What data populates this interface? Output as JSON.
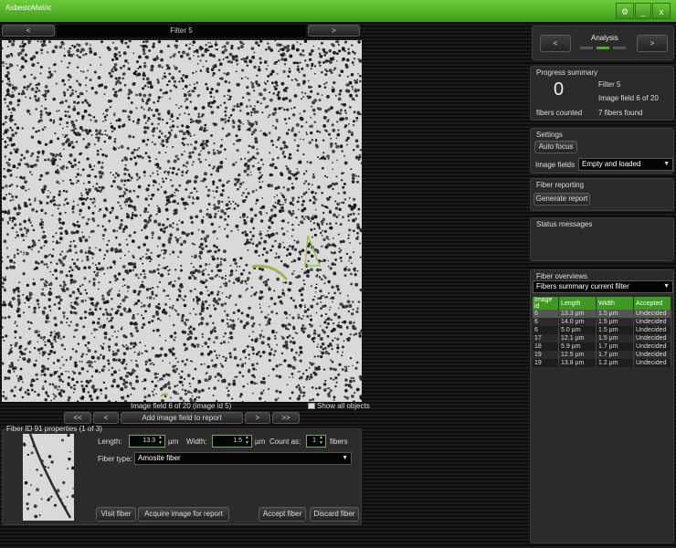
{
  "app": {
    "title": "AsbestoMetric",
    "close_label": "x",
    "minimize_label": "_"
  },
  "filter_nav": {
    "prev_label": "<",
    "title": "Filter 5",
    "next_label": ">"
  },
  "image_nav": {
    "caption": "Image field 6 of 20 (image id 5)",
    "show_all_label": "Show all objects",
    "first_label": "<<",
    "prev_label": "<",
    "add_label": "Add image field to report",
    "next_label": ">",
    "last_label": ">>"
  },
  "analysis": {
    "title": "Analysis",
    "prev_label": "<",
    "next_label": ">"
  },
  "progress": {
    "title": "Progress summary",
    "count": "0",
    "count_label": "fibers counted",
    "filter": "Filter 5",
    "image_field": "Image field 6 of 20",
    "fibers_found": "7 fibers found"
  },
  "settings": {
    "title": "Settings",
    "autofocus_label": "Auto focus",
    "image_fields_label": "Image fields",
    "image_fields_value": "Empty and loaded"
  },
  "fiber_reporting": {
    "title": "Fiber reporting",
    "generate_label": "Generate report"
  },
  "status_messages": {
    "title": "Status messages"
  },
  "fiber_overviews": {
    "title": "Fiber overviews",
    "select_value": "Fibers summary current filter",
    "columns": [
      "Image id",
      "Length",
      "Width",
      "Accepted"
    ],
    "rows": [
      [
        "6",
        "13.3 µm",
        "1.5 µm",
        "Undecided"
      ],
      [
        "6",
        "14.0 µm",
        "1.5 µm",
        "Undecided"
      ],
      [
        "6",
        "5.0 µm",
        "1.5 µm",
        "Undecided"
      ],
      [
        "17",
        "12.1 µm",
        "1.5 µm",
        "Undecided"
      ],
      [
        "18",
        "5.9 µm",
        "1.7 µm",
        "Undecided"
      ],
      [
        "19",
        "12.5 µm",
        "1.7 µm",
        "Undecided"
      ],
      [
        "19",
        "13.8 µm",
        "1.2 µm",
        "Undecided"
      ]
    ]
  },
  "fiber_props": {
    "title": "Fiber ID 91 properties (1 of 3)",
    "length_label": "Length:",
    "length_value": "13.3",
    "length_unit": "µm",
    "width_label": "Width:",
    "width_value": "1.5",
    "width_unit": "µm",
    "count_label": "Count as:",
    "count_value": "1",
    "count_unit": "fibers",
    "type_label": "Fiber type:",
    "type_value": "Amosite fiber",
    "visit_label": "Visit fiber",
    "acquire_label": "Acquire image for report",
    "accept_label": "Accept fiber",
    "discard_label": "Discard fiber"
  },
  "colors": {
    "accent": "#4caf27",
    "panel": "#2b2b2b",
    "table_header": "#3b9a1f",
    "highlight": "#a8c060"
  }
}
